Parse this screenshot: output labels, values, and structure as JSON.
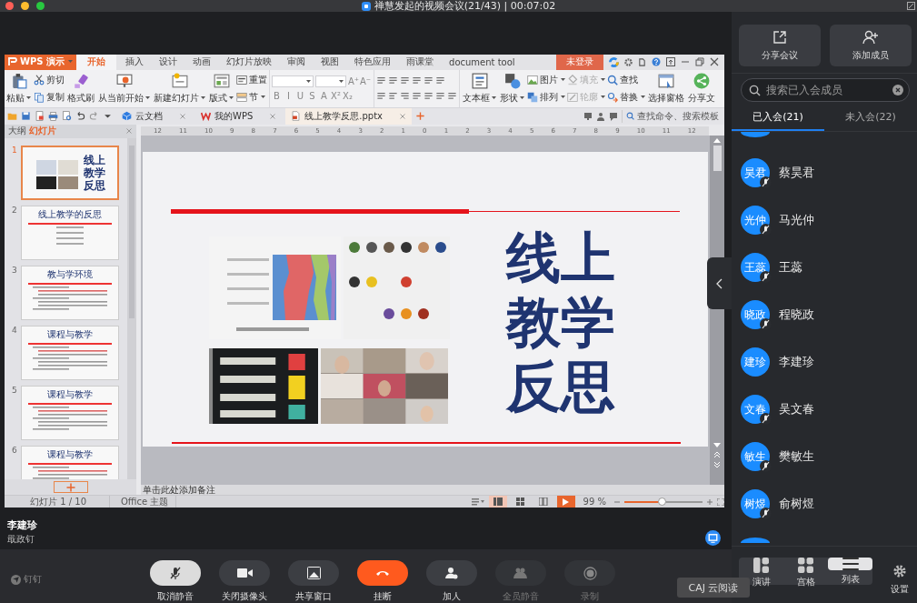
{
  "window": {
    "title": "禅慧发起的视频会议(21/43) | 00:07:02"
  },
  "wps": {
    "app_button": "WPS 演示",
    "menu_tabs": [
      {
        "label": "开始",
        "selected": true
      },
      {
        "label": "插入",
        "selected": false
      },
      {
        "label": "设计",
        "selected": false
      },
      {
        "label": "动画",
        "selected": false
      },
      {
        "label": "幻灯片放映",
        "selected": false
      },
      {
        "label": "审阅",
        "selected": false
      },
      {
        "label": "视图",
        "selected": false
      },
      {
        "label": "特色应用",
        "selected": false
      },
      {
        "label": "雨课堂",
        "selected": false
      },
      {
        "label": "document tool",
        "selected": false
      }
    ],
    "login": "未登录",
    "ribbon": [
      {
        "kind": "large",
        "items": [
          {
            "label": "粘贴",
            "dropdown": true,
            "disabled": false
          }
        ]
      },
      {
        "kind": "stack",
        "items": [
          {
            "label": "剪切",
            "dropdown": false,
            "disabled": false
          },
          {
            "label": "复制",
            "dropdown": false,
            "disabled": false
          }
        ]
      },
      {
        "kind": "large",
        "items": [
          {
            "label": "格式刷",
            "dropdown": false,
            "disabled": false
          }
        ]
      },
      {
        "kind": "large",
        "items": [
          {
            "label": "从当前开始",
            "dropdown": true,
            "disabled": false
          }
        ]
      },
      {
        "kind": "large",
        "items": [
          {
            "label": "新建幻灯片",
            "dropdown": true,
            "disabled": false
          }
        ]
      },
      {
        "kind": "large",
        "items": [
          {
            "label": "版式",
            "dropdown": true,
            "disabled": false
          }
        ]
      },
      {
        "kind": "stack",
        "items": [
          {
            "label": "重置",
            "dropdown": false,
            "disabled": false
          },
          {
            "label": "节",
            "dropdown": true,
            "disabled": false
          }
        ]
      },
      {
        "kind": "font",
        "size_buttons": [
          "A⁺",
          "A⁻"
        ],
        "format_buttons": [
          "B",
          "I",
          "U",
          "S",
          "A",
          "X²",
          "X₂"
        ]
      },
      {
        "kind": "paragraph"
      },
      {
        "kind": "large",
        "items": [
          {
            "label": "文本框",
            "dropdown": true,
            "disabled": false
          }
        ]
      },
      {
        "kind": "large",
        "items": [
          {
            "label": "形状",
            "dropdown": true,
            "disabled": false
          }
        ]
      },
      {
        "kind": "stack",
        "items": [
          {
            "label": "图片",
            "dropdown": true,
            "disabled": false
          },
          {
            "label": "排列",
            "dropdown": true,
            "disabled": false
          }
        ]
      },
      {
        "kind": "stack",
        "items": [
          {
            "label": "填充",
            "dropdown": true,
            "disabled": true
          },
          {
            "label": "轮廓",
            "dropdown": true,
            "disabled": true
          }
        ]
      },
      {
        "kind": "stack",
        "items": [
          {
            "label": "查找",
            "dropdown": false,
            "disabled": false
          },
          {
            "label": "替换",
            "dropdown": true,
            "disabled": false
          }
        ]
      },
      {
        "kind": "large",
        "items": [
          {
            "label": "选择窗格",
            "dropdown": false,
            "disabled": false
          }
        ]
      },
      {
        "kind": "large",
        "items": [
          {
            "label": "分享文",
            "dropdown": false,
            "disabled": false
          }
        ]
      }
    ],
    "doc_tabs": [
      {
        "label": "云文档",
        "selected": false
      },
      {
        "label": "我的WPS",
        "selected": false
      },
      {
        "label": "线上教学反思.pptx",
        "selected": true
      }
    ],
    "command_search": {
      "placeholder": "查找命令、搜索模板"
    },
    "panel_tabs": [
      {
        "label": "大纲",
        "selected": false
      },
      {
        "label": "幻灯片",
        "selected": true
      }
    ],
    "ruler": [
      "12",
      "11",
      "10",
      "9",
      "8",
      "7",
      "6",
      "5",
      "4",
      "3",
      "2",
      "1",
      "0",
      "1",
      "2",
      "3",
      "4",
      "5",
      "6",
      "7",
      "8",
      "9",
      "10",
      "11",
      "12"
    ],
    "slides": [
      {
        "number": "1",
        "kind": "title",
        "title_lines": [
          "线上",
          "教学",
          "反思"
        ],
        "selected": true
      },
      {
        "number": "2",
        "kind": "outline",
        "title": "线上教学的反思",
        "selected": false
      },
      {
        "number": "3",
        "kind": "text",
        "title": "教与学环境",
        "selected": false
      },
      {
        "number": "4",
        "kind": "text",
        "title": "课程与教学",
        "selected": false
      },
      {
        "number": "5",
        "kind": "text",
        "title": "课程与教学",
        "selected": false
      },
      {
        "number": "6",
        "kind": "text",
        "title": "课程与教学",
        "selected": false
      }
    ],
    "current_slide": {
      "title_lines": [
        "线上",
        "教学",
        "反思"
      ]
    },
    "notes": {
      "placeholder": "单击此处添加备注"
    },
    "status": {
      "slide_count": "幻灯片 1 / 10",
      "theme": "Office 主题",
      "views": [
        {
          "selected": true
        },
        {
          "selected": false
        },
        {
          "selected": false
        }
      ],
      "zoom": "99 %",
      "zoom_slider": {
        "level": 0.48
      }
    }
  },
  "presenter": {
    "name": "李建珍",
    "org": "戢政钉"
  },
  "brand": "钉钉",
  "controls": [
    {
      "label": "取消静音",
      "kind": "mic",
      "on": true,
      "disabled": false
    },
    {
      "label": "关闭摄像头",
      "kind": "camera",
      "on": false,
      "disabled": false
    },
    {
      "label": "共享窗口",
      "kind": "share",
      "on": false,
      "disabled": false
    },
    {
      "label": "挂断",
      "kind": "hangup",
      "on": false,
      "disabled": false
    },
    {
      "label": "加人",
      "kind": "add",
      "on": false,
      "disabled": false
    },
    {
      "label": "全员静音",
      "kind": "mute_all",
      "on": false,
      "disabled": true
    },
    {
      "label": "录制",
      "kind": "record",
      "on": false,
      "disabled": true
    }
  ],
  "tooltip": "CAJ 云阅读",
  "panel": {
    "actions": [
      {
        "label": "分享会议",
        "kind": "share"
      },
      {
        "label": "添加成员",
        "kind": "add"
      }
    ],
    "search": {
      "placeholder": "搜索已入会成员"
    },
    "tabs": [
      {
        "label": "已入会(21)",
        "selected": true
      },
      {
        "label": "未入会(22)",
        "selected": false
      }
    ],
    "members": [
      {
        "avatar": "昊君",
        "name": "蔡昊君",
        "muted": true
      },
      {
        "avatar": "光仲",
        "name": "马光仲",
        "muted": true
      },
      {
        "avatar": "王蕊",
        "name": "王蕊",
        "muted": true
      },
      {
        "avatar": "晓政",
        "name": "程晓政",
        "muted": true
      },
      {
        "avatar": "建珍",
        "name": "李建珍",
        "muted": false
      },
      {
        "avatar": "文春",
        "name": "吴文春",
        "muted": true
      },
      {
        "avatar": "敏生",
        "name": "樊敏生",
        "muted": true
      },
      {
        "avatar": "树煜",
        "name": "俞树煜",
        "muted": true
      }
    ],
    "view_modes": [
      {
        "label": "演讲",
        "kind": "speaker",
        "selected": false
      },
      {
        "label": "宫格",
        "kind": "grid",
        "selected": false
      },
      {
        "label": "列表",
        "kind": "list",
        "selected": true
      }
    ],
    "settings": "设置"
  }
}
